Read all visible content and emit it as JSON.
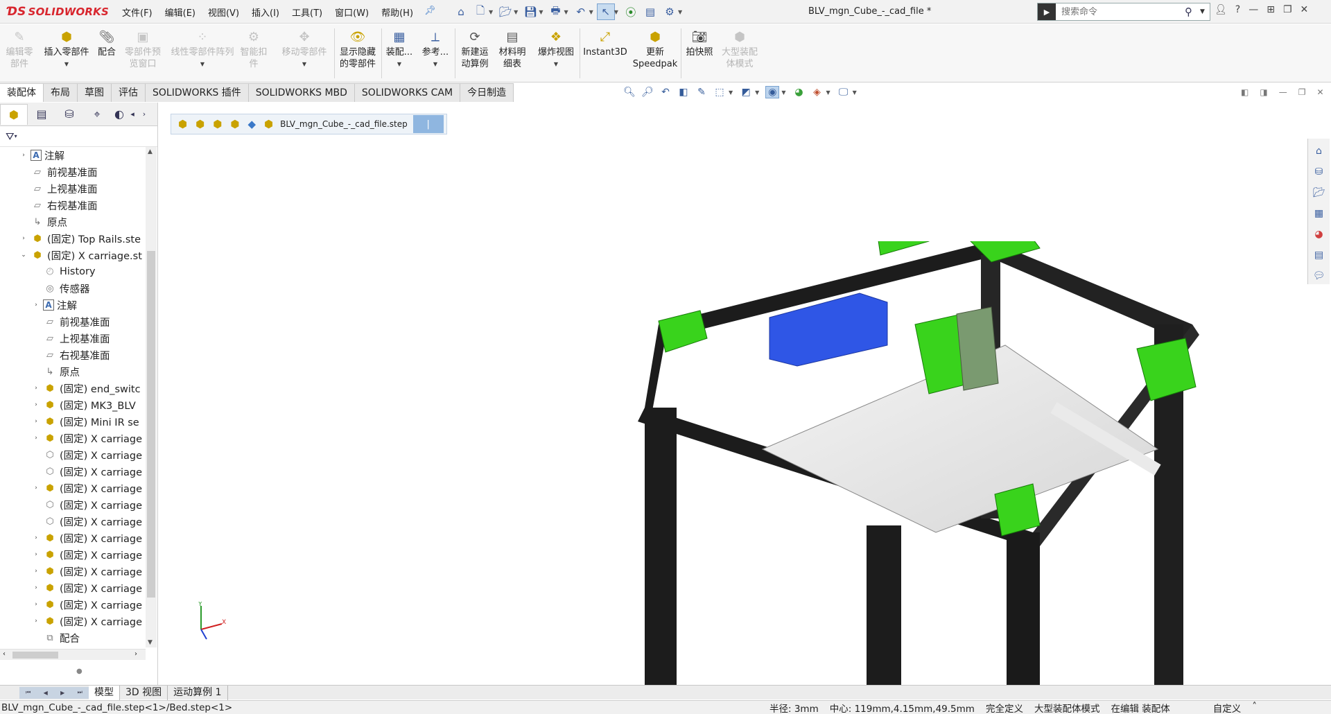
{
  "app": {
    "logo": "SOLIDWORKS",
    "menus": [
      "文件(F)",
      "编辑(E)",
      "视图(V)",
      "插入(I)",
      "工具(T)",
      "窗口(W)",
      "帮助(H)"
    ],
    "document_title": "BLV_mgn_Cube_-_cad_file *",
    "search_placeholder": "搜索命令"
  },
  "ribbon": {
    "buttons": [
      {
        "label": "编辑零\n部件",
        "enabled": false,
        "icon": "edit-component-icon"
      },
      {
        "label": "插入零部件",
        "enabled": true,
        "icon": "insert-component-icon",
        "dropdown": true
      },
      {
        "label": "配合",
        "enabled": true,
        "icon": "mate-icon"
      },
      {
        "label": "零部件预\n览窗口",
        "enabled": false,
        "icon": "preview-window-icon"
      },
      {
        "label": "线性零部件阵列",
        "enabled": false,
        "icon": "linear-pattern-icon",
        "dropdown": true
      },
      {
        "label": "智能扣\n件",
        "enabled": false,
        "icon": "smart-fastener-icon"
      },
      {
        "label": "移动零部件",
        "enabled": false,
        "icon": "move-component-icon",
        "dropdown": true
      },
      {
        "label": "显示隐藏\n的零部件",
        "enabled": true,
        "icon": "show-hidden-icon"
      },
      {
        "label": "装配...",
        "enabled": true,
        "icon": "assembly-feature-icon",
        "dropdown": true
      },
      {
        "label": "参考...",
        "enabled": true,
        "icon": "reference-geometry-icon",
        "dropdown": true
      },
      {
        "label": "新建运\n动算例",
        "enabled": true,
        "icon": "new-motion-study-icon"
      },
      {
        "label": "材料明\n细表",
        "enabled": true,
        "icon": "bom-icon"
      },
      {
        "label": "爆炸视图",
        "enabled": true,
        "icon": "exploded-view-icon",
        "dropdown": true
      },
      {
        "label": "Instant3D",
        "enabled": true,
        "icon": "instant3d-icon"
      },
      {
        "label": "更新\nSpeedpak",
        "enabled": true,
        "icon": "speedpak-icon"
      },
      {
        "label": "拍快照",
        "enabled": true,
        "icon": "snapshot-icon"
      },
      {
        "label": "大型装配\n体模式",
        "enabled": false,
        "icon": "large-assembly-icon"
      }
    ]
  },
  "tabs": [
    "装配体",
    "布局",
    "草图",
    "评估",
    "SOLIDWORKS 插件",
    "SOLIDWORKS MBD",
    "SOLIDWORKS CAM",
    "今日制造"
  ],
  "active_tab": "装配体",
  "breadcrumb": {
    "file": "BLV_mgn_Cube_-_cad_file.step"
  },
  "tree": [
    {
      "label": "注解",
      "level": 0,
      "icon": "note",
      "exp": "›"
    },
    {
      "label": "前视基准面",
      "level": 0,
      "icon": "plane",
      "exp": ""
    },
    {
      "label": "上视基准面",
      "level": 0,
      "icon": "plane",
      "exp": ""
    },
    {
      "label": "右视基准面",
      "level": 0,
      "icon": "plane",
      "exp": ""
    },
    {
      "label": "原点",
      "level": 0,
      "icon": "origin",
      "exp": ""
    },
    {
      "label": "(固定) Top Rails.ste",
      "level": 0,
      "icon": "asm",
      "exp": "›"
    },
    {
      "label": "(固定) X carriage.st",
      "level": 0,
      "icon": "asm",
      "exp": "⌄"
    },
    {
      "label": "History",
      "level": 1,
      "icon": "history",
      "exp": ""
    },
    {
      "label": "传感器",
      "level": 1,
      "icon": "sensor",
      "exp": ""
    },
    {
      "label": "注解",
      "level": 1,
      "icon": "note",
      "exp": "›"
    },
    {
      "label": "前视基准面",
      "level": 1,
      "icon": "plane",
      "exp": ""
    },
    {
      "label": "上视基准面",
      "level": 1,
      "icon": "plane",
      "exp": ""
    },
    {
      "label": "右视基准面",
      "level": 1,
      "icon": "plane",
      "exp": ""
    },
    {
      "label": "原点",
      "level": 1,
      "icon": "origin",
      "exp": ""
    },
    {
      "label": "(固定) end_switc",
      "level": 1,
      "icon": "asm",
      "exp": "›"
    },
    {
      "label": "(固定) MK3_BLV",
      "level": 1,
      "icon": "asm",
      "exp": "›"
    },
    {
      "label": "(固定) Mini IR se",
      "level": 1,
      "icon": "asm",
      "exp": "›"
    },
    {
      "label": "(固定) X carriage",
      "level": 1,
      "icon": "asm",
      "exp": "›"
    },
    {
      "label": "(固定) X carriage",
      "level": 1,
      "icon": "part",
      "exp": ""
    },
    {
      "label": "(固定) X carriage",
      "level": 1,
      "icon": "part",
      "exp": ""
    },
    {
      "label": "(固定) X carriage",
      "level": 1,
      "icon": "asm",
      "exp": "›"
    },
    {
      "label": "(固定) X carriage",
      "level": 1,
      "icon": "part",
      "exp": ""
    },
    {
      "label": "(固定) X carriage",
      "level": 1,
      "icon": "part",
      "exp": ""
    },
    {
      "label": "(固定) X carriage",
      "level": 1,
      "icon": "asm",
      "exp": "›"
    },
    {
      "label": "(固定) X carriage",
      "level": 1,
      "icon": "asm",
      "exp": "›"
    },
    {
      "label": "(固定) X carriage",
      "level": 1,
      "icon": "asm",
      "exp": "›"
    },
    {
      "label": "(固定) X carriage",
      "level": 1,
      "icon": "asm",
      "exp": "›"
    },
    {
      "label": "(固定) X carriage",
      "level": 1,
      "icon": "asm",
      "exp": "›"
    },
    {
      "label": "(固定) X carriage",
      "level": 1,
      "icon": "asm",
      "exp": "›"
    },
    {
      "label": "配合",
      "level": 1,
      "icon": "mate",
      "exp": ""
    }
  ],
  "bottom_tabs": [
    "模型",
    "3D 视图",
    "运动算例 1"
  ],
  "status": {
    "path": "BLV_mgn_Cube_-_cad_file.step<1>/Bed.step<1>",
    "radius": "半径: 3mm",
    "center": "中心: 119mm,4.15mm,49.5mm",
    "definition": "完全定义",
    "mode": "大型装配体模式",
    "editing": "在编辑 装配体",
    "custom": "自定义"
  },
  "colors": {
    "brand": "#d8262e",
    "part_green": "#39d31c",
    "part_blue": "#2f56e6",
    "frame": "#1c1c1c"
  }
}
